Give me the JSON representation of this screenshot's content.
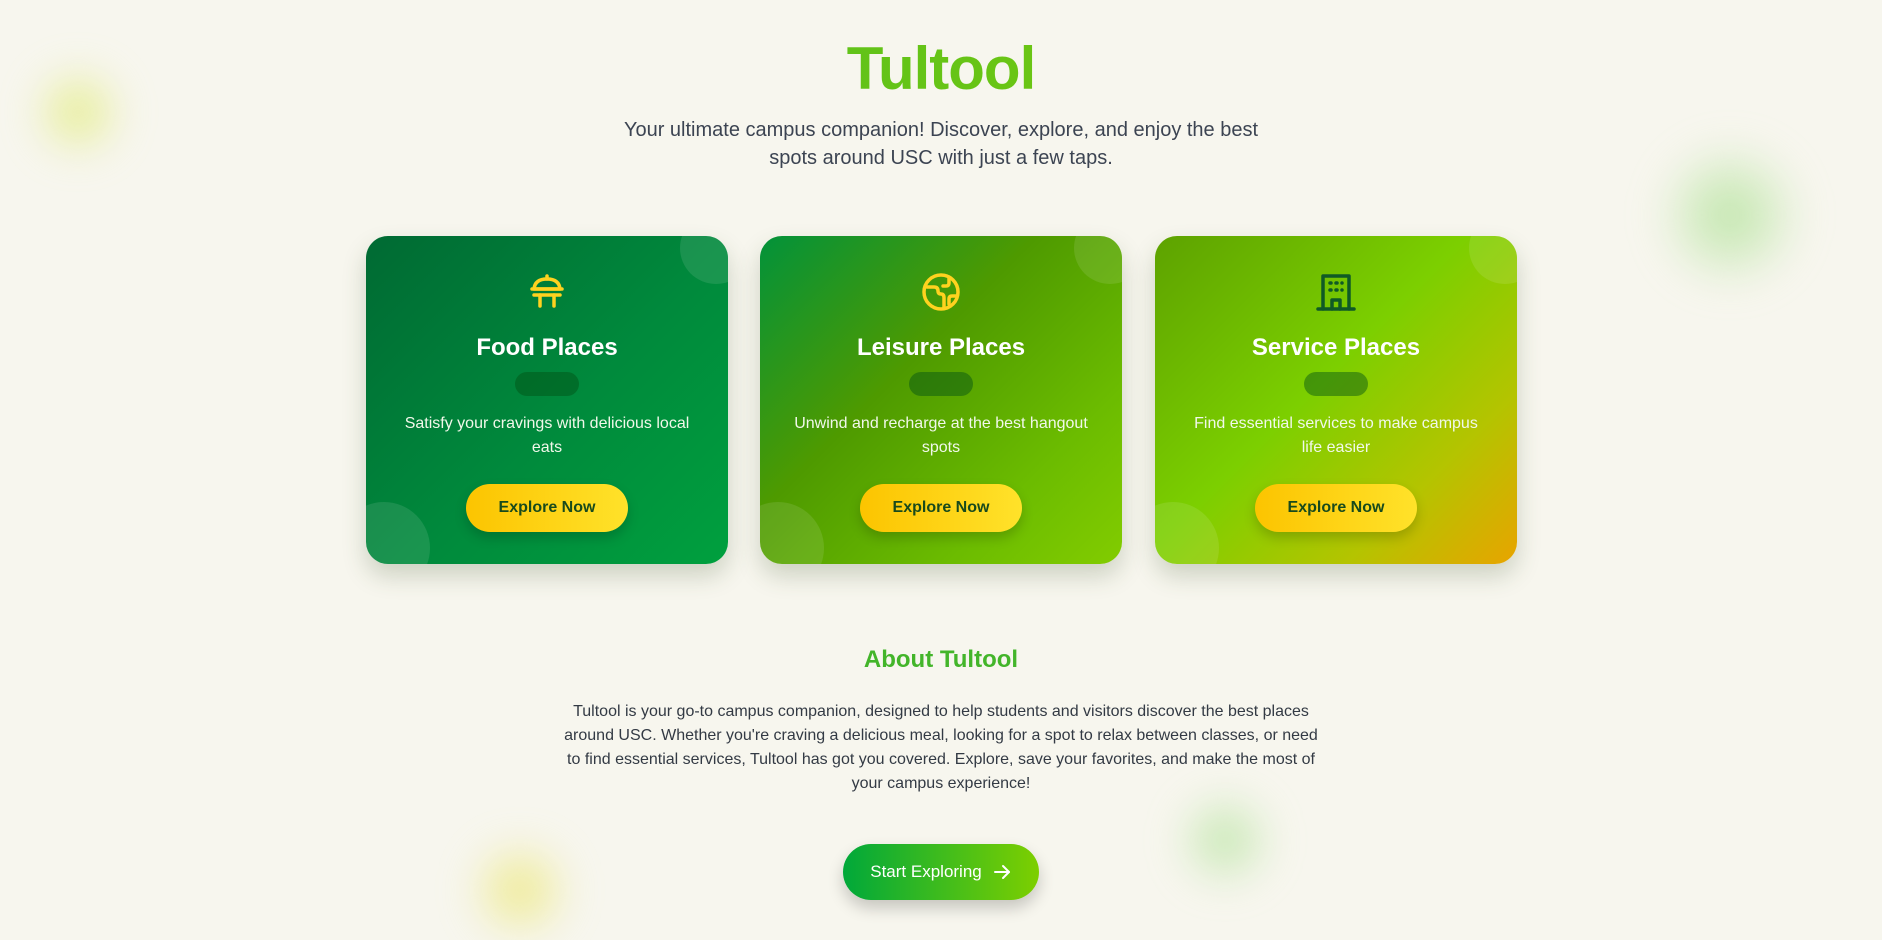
{
  "header": {
    "title": "Tultool",
    "subtitle": "Your ultimate campus companion! Discover, explore, and enjoy the best spots around USC with just a few taps."
  },
  "cards": [
    {
      "title": "Food Places",
      "description": "Satisfy your cravings with delicious local eats",
      "button": "Explore Now",
      "icon": "food-table-icon",
      "icon_color": "#ffd21f"
    },
    {
      "title": "Leisure Places",
      "description": "Unwind and recharge at the best hangout spots",
      "button": "Explore Now",
      "icon": "globe-icon",
      "icon_color": "#ffd21f"
    },
    {
      "title": "Service Places",
      "description": "Find essential services to make campus life easier",
      "button": "Explore Now",
      "icon": "building-icon",
      "icon_color": "#0f5a26"
    }
  ],
  "about": {
    "title": "About Tultool",
    "text": "Tultool is your go-to campus companion, designed to help students and visitors discover the best places around USC. Whether you're craving a delicious meal, looking for a spot to relax between classes, or need to find essential services, Tultool has got you covered. Explore, save your favorites, and make the most of your campus experience!"
  },
  "cta": {
    "label": "Start Exploring",
    "icon": "arrow-right-icon"
  },
  "colors": {
    "background": "#f7f6ee",
    "title_green": "#6cc417",
    "accent_yellow": "#fcc400",
    "about_title": "#43b52a"
  }
}
